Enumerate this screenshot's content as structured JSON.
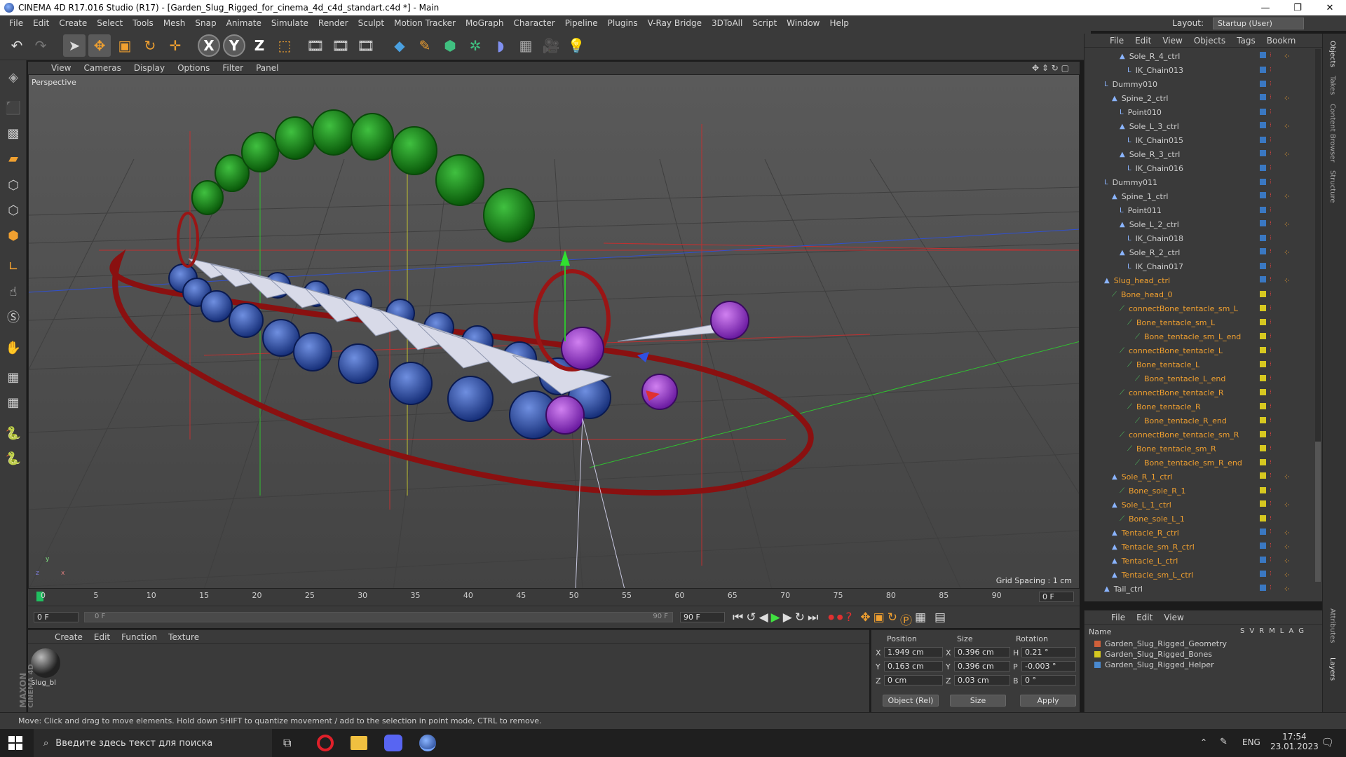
{
  "window": {
    "title": "CINEMA 4D R17.016 Studio (R17) - [Garden_Slug_Rigged_for_cinema_4d_c4d_standart.c4d *] - Main",
    "controls": [
      "—",
      "❐",
      "✕"
    ]
  },
  "menubar": {
    "items": [
      "File",
      "Edit",
      "Create",
      "Select",
      "Tools",
      "Mesh",
      "Snap",
      "Animate",
      "Simulate",
      "Render",
      "Sculpt",
      "Motion Tracker",
      "MoGraph",
      "Character",
      "Pipeline",
      "Plugins",
      "V-Ray Bridge",
      "3DToAll",
      "Script",
      "Window",
      "Help"
    ],
    "layout_label": "Layout:",
    "layout_value": "Startup (User)"
  },
  "toolbar": {
    "axis_x": "X",
    "axis_y": "Y",
    "axis_z": "Z"
  },
  "viewport": {
    "menu": [
      "View",
      "Cameras",
      "Display",
      "Options",
      "Filter",
      "Panel"
    ],
    "label": "Perspective",
    "grid_spacing": "Grid Spacing : 1 cm",
    "axis_labels": [
      "y",
      "x",
      "z"
    ]
  },
  "timeline": {
    "ticks": [
      "0",
      "5",
      "10",
      "15",
      "20",
      "25",
      "30",
      "35",
      "40",
      "45",
      "50",
      "55",
      "60",
      "65",
      "70",
      "75",
      "80",
      "85",
      "90"
    ],
    "current_frame_display": "0 F",
    "start_field": "0 F",
    "slider_start": "0 F",
    "slider_end": "90 F",
    "end_field": "90 F"
  },
  "material_panel": {
    "menu": [
      "Create",
      "Edit",
      "Function",
      "Texture"
    ],
    "material_name": "Slug_bl",
    "brand_line1": "MAXON",
    "brand_line2": "CINEMA 4D"
  },
  "coords": {
    "headers": [
      "Position",
      "Size",
      "Rotation"
    ],
    "rows": [
      {
        "axis": "X",
        "pos": "1.949 cm",
        "saxis": "X",
        "size": "0.396 cm",
        "raxis": "H",
        "rot": "0.21 °"
      },
      {
        "axis": "Y",
        "pos": "0.163 cm",
        "saxis": "Y",
        "size": "0.396 cm",
        "raxis": "P",
        "rot": "-0.003 °"
      },
      {
        "axis": "Z",
        "pos": "0 cm",
        "saxis": "Z",
        "size": "0.03 cm",
        "raxis": "B",
        "rot": "0 °"
      }
    ],
    "mode": "Object (Rel)",
    "size_mode": "Size",
    "apply": "Apply"
  },
  "object_manager": {
    "menu": [
      "File",
      "Edit",
      "View",
      "Objects",
      "Tags",
      "Bookm"
    ],
    "rows": [
      {
        "indent": 4,
        "name": "Sole_R_4_ctrl",
        "type": "ctrl",
        "color": "#3a78c2"
      },
      {
        "indent": 5,
        "name": "IK_Chain013",
        "type": "ik",
        "color": "#3a78c2"
      },
      {
        "indent": 2,
        "name": "Dummy010",
        "type": "null",
        "color": "#3a78c2"
      },
      {
        "indent": 3,
        "name": "Spine_2_ctrl",
        "type": "ctrl",
        "color": "#3a78c2"
      },
      {
        "indent": 4,
        "name": "Point010",
        "type": "null",
        "color": "#3a78c2"
      },
      {
        "indent": 4,
        "name": "Sole_L_3_ctrl",
        "type": "ctrl",
        "color": "#3a78c2"
      },
      {
        "indent": 5,
        "name": "IK_Chain015",
        "type": "ik",
        "color": "#3a78c2"
      },
      {
        "indent": 4,
        "name": "Sole_R_3_ctrl",
        "type": "ctrl",
        "color": "#3a78c2"
      },
      {
        "indent": 5,
        "name": "IK_Chain016",
        "type": "ik",
        "color": "#3a78c2"
      },
      {
        "indent": 2,
        "name": "Dummy011",
        "type": "null",
        "color": "#3a78c2"
      },
      {
        "indent": 3,
        "name": "Spine_1_ctrl",
        "type": "ctrl",
        "color": "#3a78c2"
      },
      {
        "indent": 4,
        "name": "Point011",
        "type": "null",
        "color": "#3a78c2"
      },
      {
        "indent": 4,
        "name": "Sole_L_2_ctrl",
        "type": "ctrl",
        "color": "#3a78c2"
      },
      {
        "indent": 5,
        "name": "IK_Chain018",
        "type": "ik",
        "color": "#3a78c2"
      },
      {
        "indent": 4,
        "name": "Sole_R_2_ctrl",
        "type": "ctrl",
        "color": "#3a78c2"
      },
      {
        "indent": 5,
        "name": "IK_Chain017",
        "type": "ik",
        "color": "#3a78c2"
      },
      {
        "indent": 2,
        "name": "Slug_head_ctrl",
        "type": "ctrl",
        "color": "#3a78c2",
        "highlight": true
      },
      {
        "indent": 3,
        "name": "Bone_head_0",
        "type": "bone",
        "color": "#d6c820",
        "highlight": true
      },
      {
        "indent": 4,
        "name": "connectBone_tentacle_sm_L",
        "type": "bone",
        "color": "#d6c820",
        "highlight": true
      },
      {
        "indent": 5,
        "name": "Bone_tentacle_sm_L",
        "type": "bone",
        "color": "#d6c820",
        "highlight": true
      },
      {
        "indent": 6,
        "name": "Bone_tentacle_sm_L_end",
        "type": "bone",
        "color": "#d6c820",
        "highlight": true
      },
      {
        "indent": 4,
        "name": "connectBone_tentacle_L",
        "type": "bone",
        "color": "#d6c820",
        "highlight": true
      },
      {
        "indent": 5,
        "name": "Bone_tentacle_L",
        "type": "bone",
        "color": "#d6c820",
        "highlight": true
      },
      {
        "indent": 6,
        "name": "Bone_tentacle_L_end",
        "type": "bone",
        "color": "#d6c820",
        "highlight": true
      },
      {
        "indent": 4,
        "name": "connectBone_tentacle_R",
        "type": "bone",
        "color": "#d6c820",
        "highlight": true
      },
      {
        "indent": 5,
        "name": "Bone_tentacle_R",
        "type": "bone",
        "color": "#d6c820",
        "highlight": true
      },
      {
        "indent": 6,
        "name": "Bone_tentacle_R_end",
        "type": "bone",
        "color": "#d6c820",
        "highlight": true
      },
      {
        "indent": 4,
        "name": "connectBone_tentacle_sm_R",
        "type": "bone",
        "color": "#d6c820",
        "highlight": true
      },
      {
        "indent": 5,
        "name": "Bone_tentacle_sm_R",
        "type": "bone",
        "color": "#d6c820",
        "highlight": true
      },
      {
        "indent": 6,
        "name": "Bone_tentacle_sm_R_end",
        "type": "bone",
        "color": "#d6c820",
        "highlight": true
      },
      {
        "indent": 3,
        "name": "Sole_R_1_ctrl",
        "type": "ctrl",
        "color": "#d6c820",
        "highlight": true
      },
      {
        "indent": 4,
        "name": "Bone_sole_R_1",
        "type": "bone",
        "color": "#d6c820",
        "highlight": true
      },
      {
        "indent": 3,
        "name": "Sole_L_1_ctrl",
        "type": "ctrl",
        "color": "#d6c820",
        "highlight": true
      },
      {
        "indent": 4,
        "name": "Bone_sole_L_1",
        "type": "bone",
        "color": "#d6c820",
        "highlight": true
      },
      {
        "indent": 3,
        "name": "Tentacle_R_ctrl",
        "type": "ctrl",
        "color": "#3a78c2",
        "highlight": true
      },
      {
        "indent": 3,
        "name": "Tentacle_sm_R_ctrl",
        "type": "ctrl",
        "color": "#3a78c2",
        "highlight": true
      },
      {
        "indent": 3,
        "name": "Tentacle_L_ctrl",
        "type": "ctrl",
        "color": "#3a78c2",
        "highlight": true
      },
      {
        "indent": 3,
        "name": "Tentacle_sm_L_ctrl",
        "type": "ctrl",
        "color": "#3a78c2",
        "highlight": true
      },
      {
        "indent": 2,
        "name": "Tail_ctrl",
        "type": "ctrl",
        "color": "#3a78c2"
      }
    ]
  },
  "layers": {
    "menu": [
      "File",
      "Edit",
      "View"
    ],
    "col_name": "Name",
    "cols": [
      "S",
      "V",
      "R",
      "M",
      "L",
      "A",
      "G"
    ],
    "rows": [
      {
        "name": "Garden_Slug_Rigged_Geometry",
        "color": "#d0603a"
      },
      {
        "name": "Garden_Slug_Rigged_Bones",
        "color": "#d6c820"
      },
      {
        "name": "Garden_Slug_Rigged_Helper",
        "color": "#4a8ad0"
      }
    ]
  },
  "right_tabs": [
    "Objects",
    "Takes",
    "Content Browser",
    "Structure",
    "Attributes",
    "Layers"
  ],
  "status": "Move: Click and drag to move elements. Hold down SHIFT to quantize movement / add to the selection in point mode, CTRL to remove.",
  "taskbar": {
    "search_placeholder": "Введите здесь текст для поиска",
    "lang": "ENG",
    "time": "17:54",
    "date": "23.01.2023"
  }
}
